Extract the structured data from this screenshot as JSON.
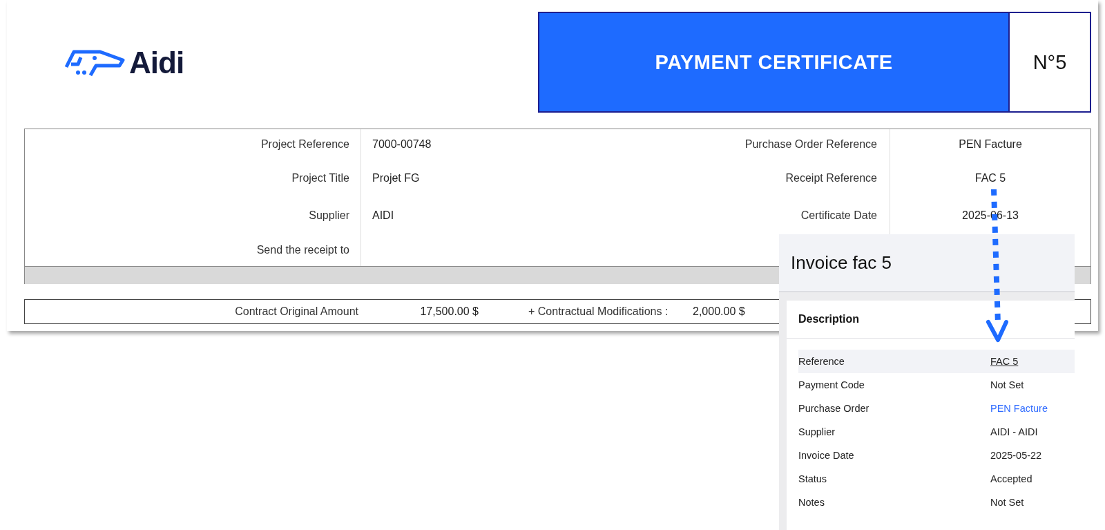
{
  "logo": {
    "text": "Aidi"
  },
  "header": {
    "title": "PAYMENT CERTIFICATE",
    "number": "N°5"
  },
  "info": {
    "left": [
      {
        "label": "Project Reference",
        "value": "7000-00748"
      },
      {
        "label": "Project Title",
        "value": "Projet FG"
      },
      {
        "label": "Supplier",
        "value": "AIDI"
      },
      {
        "label": "Send the receipt to"
      }
    ],
    "right": [
      {
        "label": "Purchase Order Reference",
        "value": "PEN Facture"
      },
      {
        "label": "Receipt Reference",
        "value": "FAC 5"
      },
      {
        "label": "Certificate Date",
        "value": "2025-06-13"
      }
    ]
  },
  "amounts": [
    {
      "label": "Contract Original Amount",
      "value": "17,500.00 $"
    },
    {
      "label": "+ Contractual Modifications :",
      "value": "2,000.00 $"
    }
  ],
  "invoice_panel": {
    "title": "Invoice fac 5",
    "section": "Description",
    "rows": [
      {
        "label": "Reference",
        "value": "FAC 5",
        "kind": "text",
        "selected": true
      },
      {
        "label": "Payment Code",
        "value": "Not Set",
        "kind": "text",
        "selected": false
      },
      {
        "label": "Purchase Order",
        "value": "PEN Facture",
        "kind": "link",
        "selected": false
      },
      {
        "label": "Supplier",
        "value": "AIDI - AIDI",
        "kind": "text",
        "selected": false
      },
      {
        "label": "Invoice Date",
        "value": "2025-05-22",
        "kind": "text",
        "selected": false
      },
      {
        "label": "Status",
        "value": "Accepted",
        "kind": "text",
        "selected": false
      },
      {
        "label": "Notes",
        "value": "Not Set",
        "kind": "text",
        "selected": false
      }
    ]
  }
}
